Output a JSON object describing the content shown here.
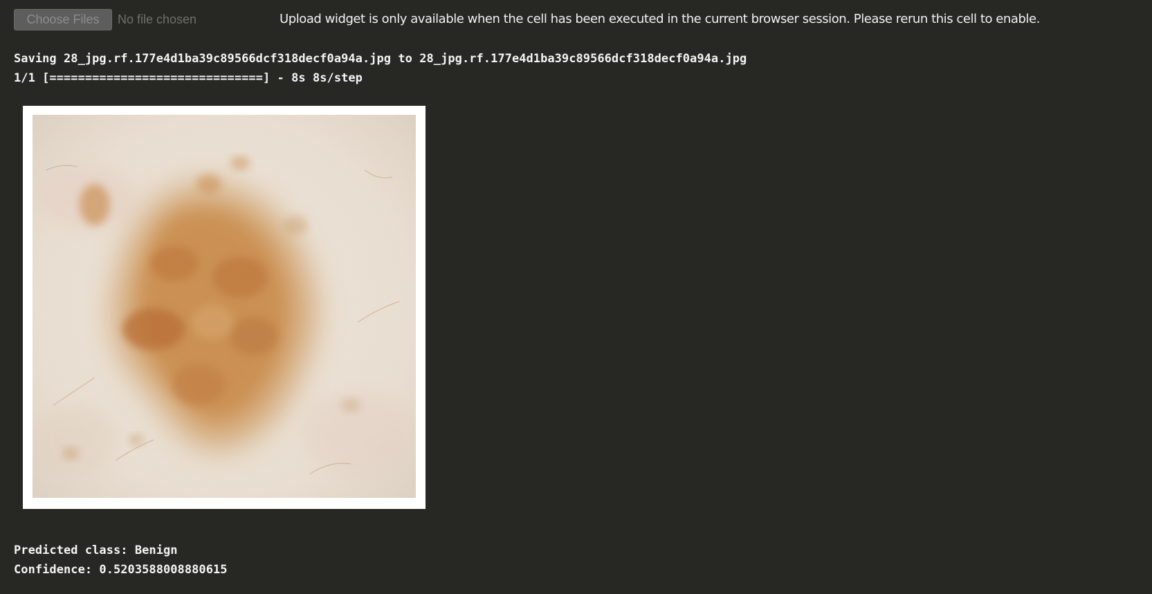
{
  "upload": {
    "button_label": "Choose Files",
    "status_text": "No file chosen",
    "note": "Upload widget is only available when the cell has been executed in the current browser session. Please rerun this cell to enable."
  },
  "output": {
    "saving_line": "Saving 28_jpg.rf.177e4d1ba39c89566dcf318decf0a94a.jpg to 28_jpg.rf.177e4d1ba39c89566dcf318decf0a94a.jpg",
    "progress_line": "1/1 [==============================] - 8s 8s/step",
    "predicted_line": "Predicted class: Benign",
    "confidence_line": "Confidence: 0.5203588008880615"
  },
  "image": {
    "subject": "dermoscopic-skin-lesion",
    "skin_color": "#ece3d8",
    "lesion_color": "#c98a4a",
    "lesion_dark_color": "#b36a33"
  },
  "colors": {
    "background": "#272823",
    "text": "#f5f5f5",
    "button_bg": "#5d5d5d",
    "button_text": "#8d8d8d"
  }
}
